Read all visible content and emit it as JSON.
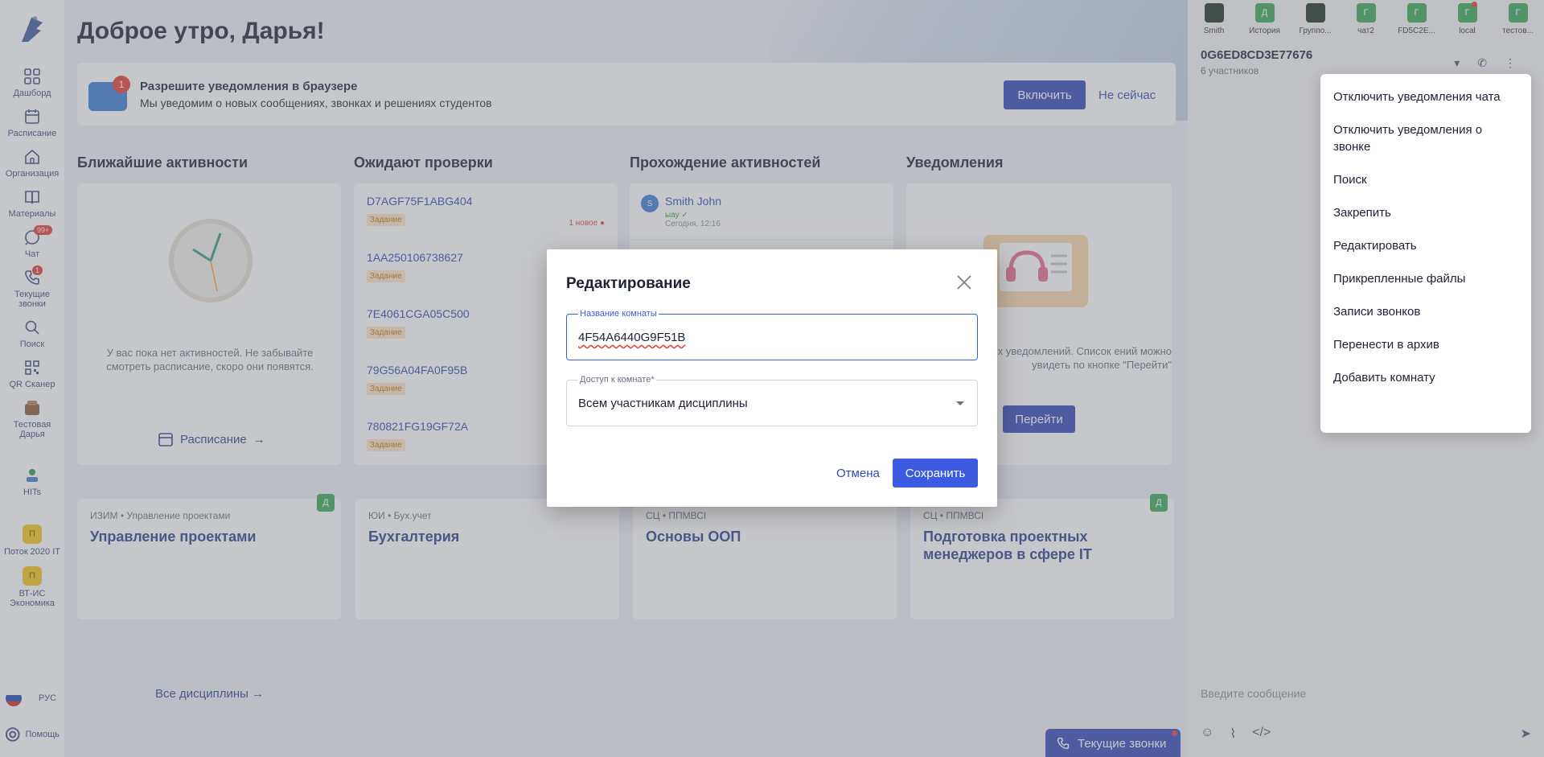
{
  "sidebar": {
    "items": [
      {
        "label": "Дашборд",
        "icon": "dashboard-icon"
      },
      {
        "label": "Расписание",
        "icon": "calendar-icon"
      },
      {
        "label": "Организация",
        "icon": "home-icon"
      },
      {
        "label": "Материалы",
        "icon": "book-icon"
      },
      {
        "label": "Чат",
        "icon": "chat-icon",
        "badge": "99+"
      },
      {
        "label": "Текущие звонки",
        "icon": "phone-icon",
        "badge": "1"
      },
      {
        "label": "Поиск",
        "icon": "search-icon"
      },
      {
        "label": "QR Сканер",
        "icon": "qr-icon"
      },
      {
        "label": "Тестовая Дарья",
        "icon": "avatar-icon"
      },
      {
        "label": "HITs",
        "icon": "hits-icon"
      }
    ],
    "courses": [
      {
        "chip": "П",
        "label": "Поток 2020 IT"
      },
      {
        "chip": "П",
        "label": "ВТ-ИС Экономика"
      }
    ],
    "language": "РУС",
    "help": "Помощь"
  },
  "header": {
    "greeting": "Доброе утро, Дарья!"
  },
  "notification_bar": {
    "badge": "1",
    "title": "Разрешите уведомления в браузере",
    "subtitle": "Мы уведомим о новых сообщениях, звонках и решениях студентов",
    "enable_label": "Включить",
    "later_label": "Не сейчас"
  },
  "columns": {
    "upcoming": {
      "title": "Ближайшие активности",
      "empty_text": "У вас пока нет активностей. Не забывайте смотреть расписание, скоро они появятся.",
      "link": "Расписание"
    },
    "review": {
      "title": "Ожидают проверки",
      "items": [
        {
          "id": "D7AGF75F1ABG404",
          "tag": "Задание",
          "new": "1 новое"
        },
        {
          "id": "1AA250106738627",
          "tag": "Задание"
        },
        {
          "id": "7E4061CGA05C500",
          "tag": "Задание"
        },
        {
          "id": "79G56A04FA0F95B",
          "tag": "Задание"
        },
        {
          "id": "780821FG19GF72A",
          "tag": "Задание"
        }
      ]
    },
    "progress": {
      "title": "Прохождение активностей",
      "items": [
        {
          "avatar": "S",
          "name": "Smith John",
          "msg": "ыау ✓",
          "time": "Сегодня, 12:16"
        }
      ]
    },
    "notifications": {
      "title": "Уведомления",
      "text": "олученных уведомлений. Список ений можно увидеть по кнопке \"Перейти\"",
      "button": "Перейти"
    }
  },
  "disciplines": [
    {
      "meta": "ИЗИМ • Управление проектами",
      "title": "Управление проектами",
      "chip": "Д"
    },
    {
      "meta": "ЮИ • Бух.учет",
      "title": "Бухгалтерия"
    },
    {
      "meta": "СЦ • ППМВСI",
      "title": "Основы ООП"
    },
    {
      "meta": "СЦ • ППМВСI",
      "title": "Подготовка проектных менеджеров в сфере IT",
      "chip": "Д"
    }
  ],
  "all_disciplines": "Все дисциплины",
  "current_calls": "Текущие звонки",
  "chat": {
    "tabs": [
      {
        "avatar": "",
        "label": "Smith"
      },
      {
        "avatar": "Д",
        "label": "История"
      },
      {
        "avatar": "",
        "label": "Группо..."
      },
      {
        "avatar": "Г",
        "label": "чат2"
      },
      {
        "avatar": "Г",
        "label": "FD5C2E..."
      },
      {
        "avatar": "Г",
        "label": "local"
      },
      {
        "avatar": "Г",
        "label": "тестов..."
      }
    ],
    "room_name": "0G6ED8CD3E77676",
    "participants": "6 участников",
    "input_placeholder": "Введите сообщение"
  },
  "context_menu": [
    "Отключить уведомления чата",
    "Отключить уведомления о звонке",
    "Поиск",
    "Закрепить",
    "Редактировать",
    "Прикрепленные файлы",
    "Записи звонков",
    "Перенести в архив",
    "Добавить комнату"
  ],
  "modal": {
    "title": "Редактирование",
    "room_label": "Название комнаты",
    "room_value": "4F54A6440G9F51B",
    "access_label": "Доступ к комнате*",
    "access_value": "Всем участникам дисциплины",
    "cancel": "Отмена",
    "save": "Сохранить"
  },
  "colors": {
    "primary": "#3048b8",
    "accent": "#3c5be0",
    "badge": "#e53935",
    "tag_bg": "#fde6c8"
  }
}
